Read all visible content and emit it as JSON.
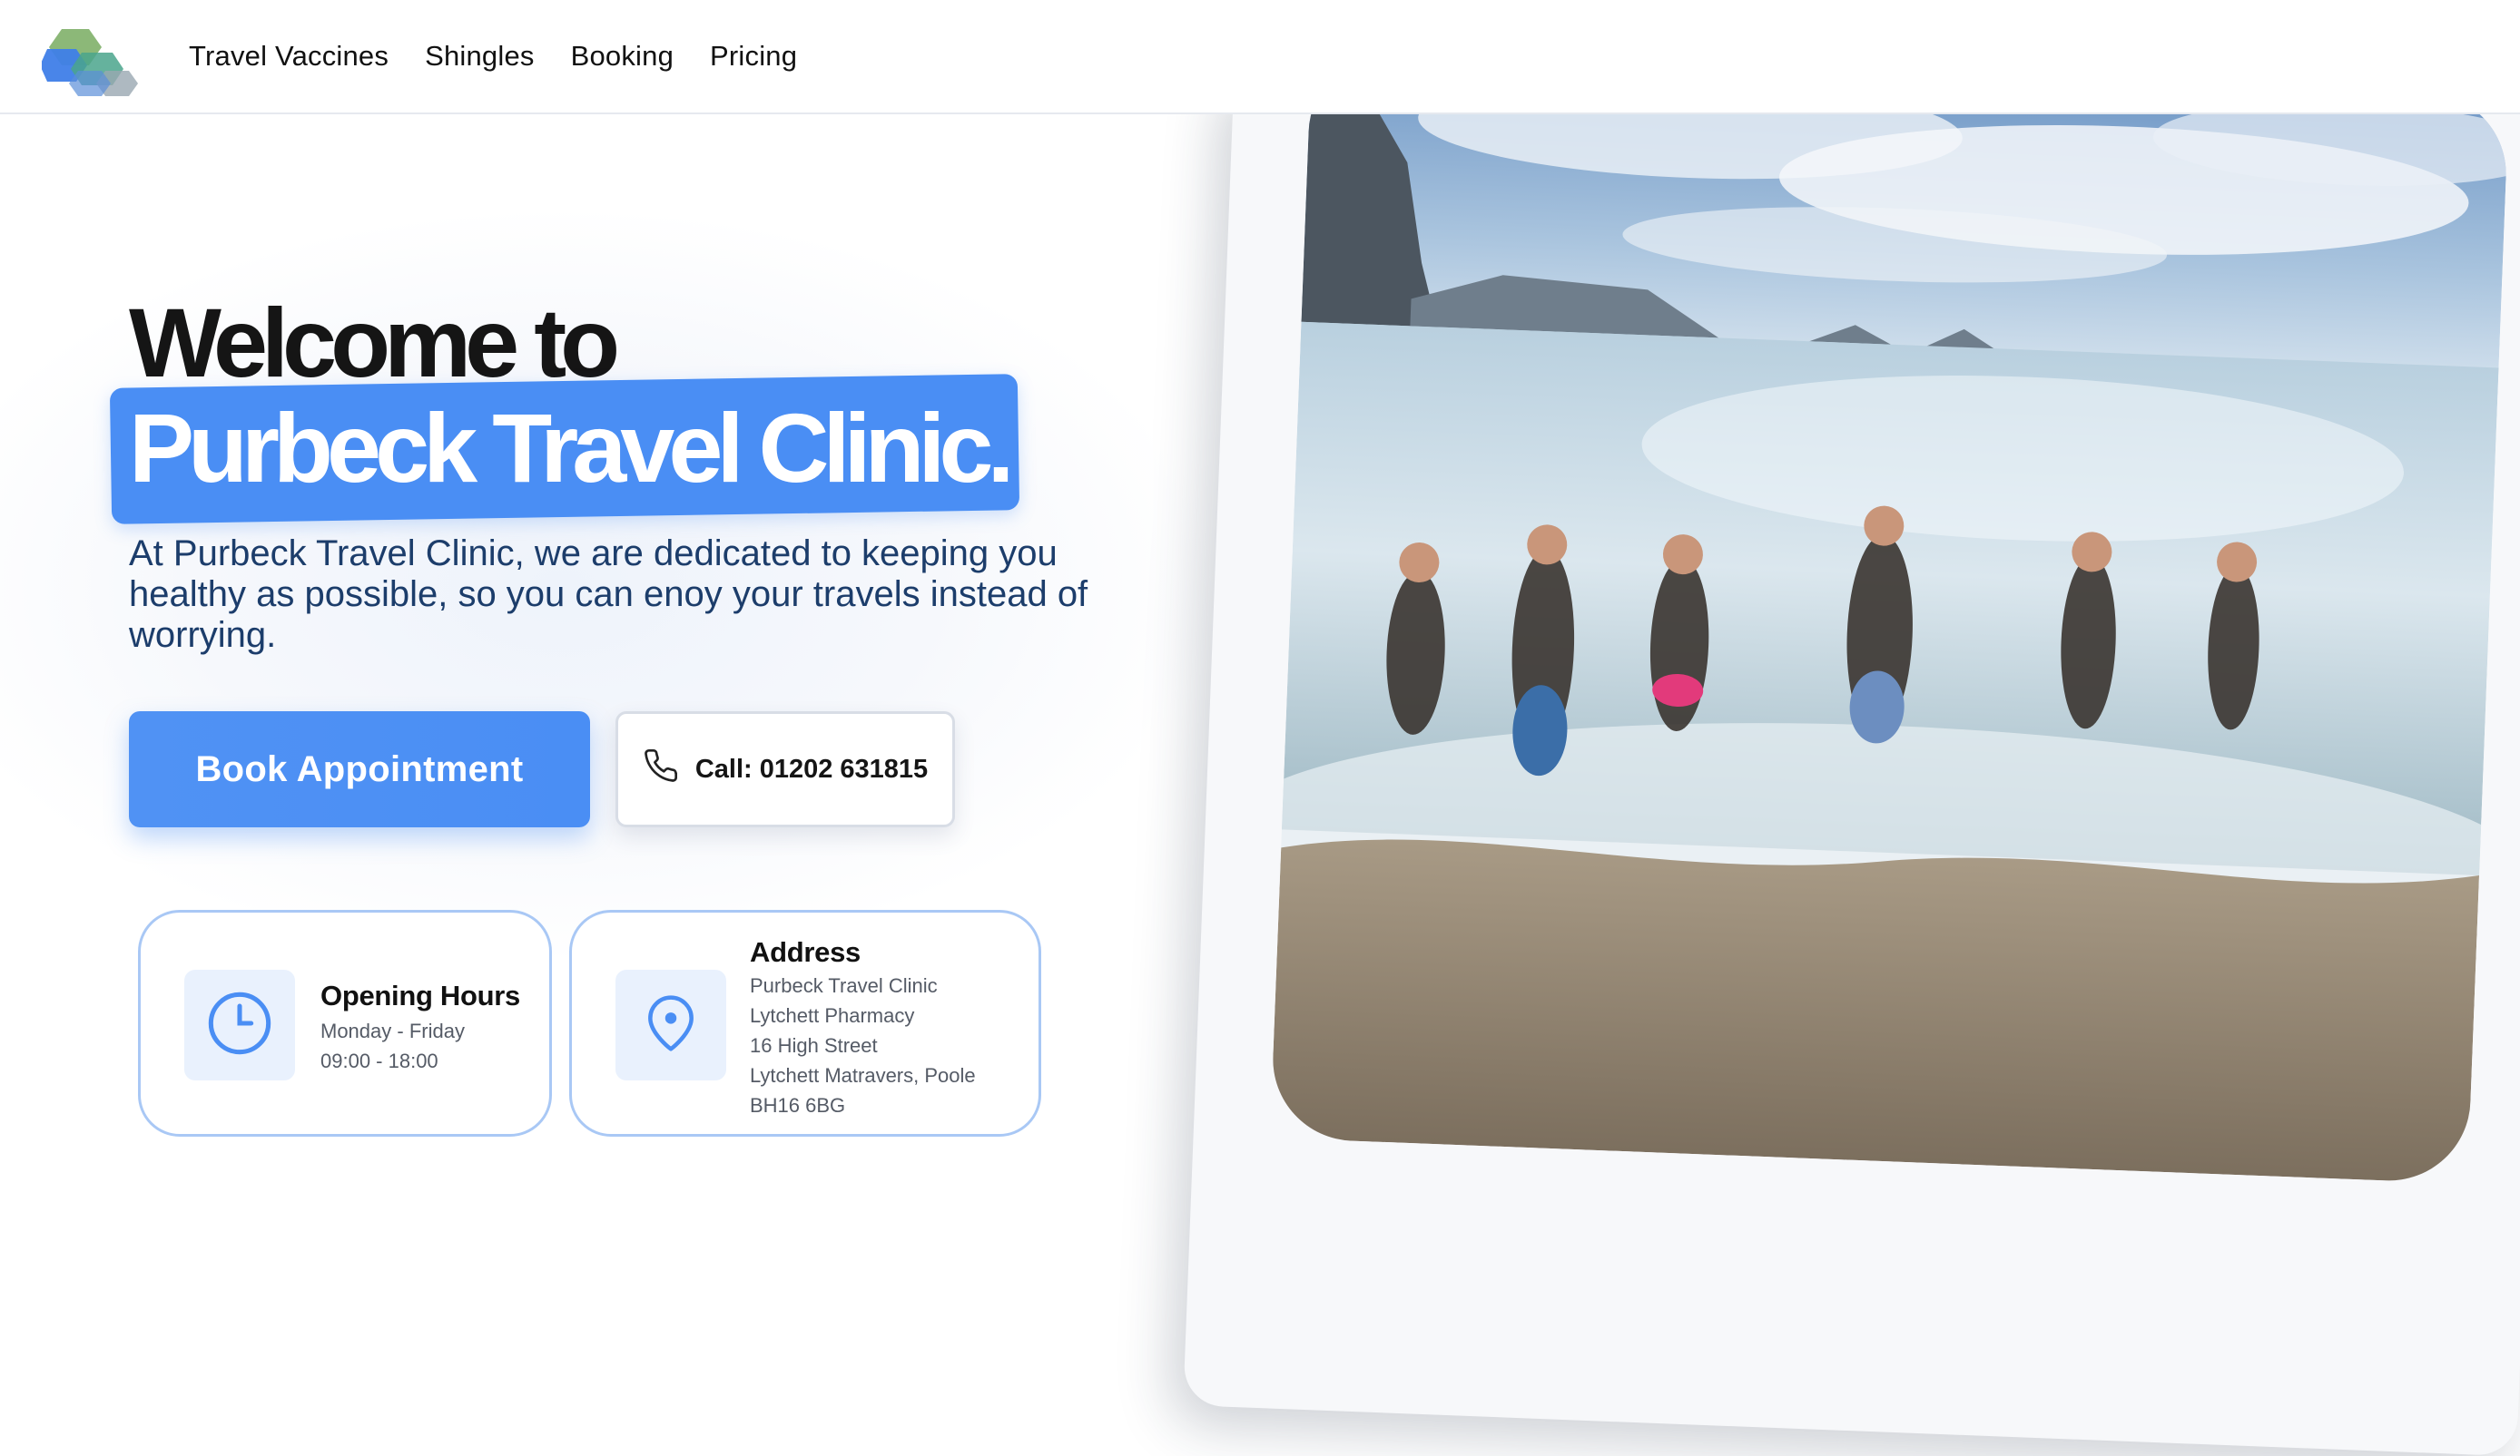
{
  "header": {
    "logo": "clinic-logo",
    "nav": [
      {
        "label": "Travel Vaccines"
      },
      {
        "label": "Shingles"
      },
      {
        "label": "Booking"
      },
      {
        "label": "Pricing"
      }
    ]
  },
  "hero": {
    "heading_line1": "Welcome to",
    "heading_line2": "Purbeck Travel Clinic.",
    "intro": "At Purbeck Travel Clinic, we are dedicated to keeping you healthy as possible, so you can enoy your travels instead of worrying.",
    "book_label": "Book Appointment",
    "call_label": "Call: 01202 631815",
    "call_icon": "phone-icon",
    "image": "beach-photo"
  },
  "hours_card": {
    "title": "Opening Hours",
    "days": "Monday - Friday",
    "time": "09:00 - 18:00",
    "icon": "clock-icon"
  },
  "address_card": {
    "title": "Address",
    "lines": [
      "Purbeck Travel Clinic",
      "Lytchett Pharmacy",
      "16 High Street",
      "Lytchett Matravers, Poole",
      "BH16 6BG"
    ],
    "icon": "map-pin-icon"
  },
  "colors": {
    "accent": "#4a8ef4",
    "heading": "#151515",
    "body_text": "#1c3d6b",
    "card_border": "#a9c8f5",
    "icon_bg": "#e9f1fd"
  }
}
